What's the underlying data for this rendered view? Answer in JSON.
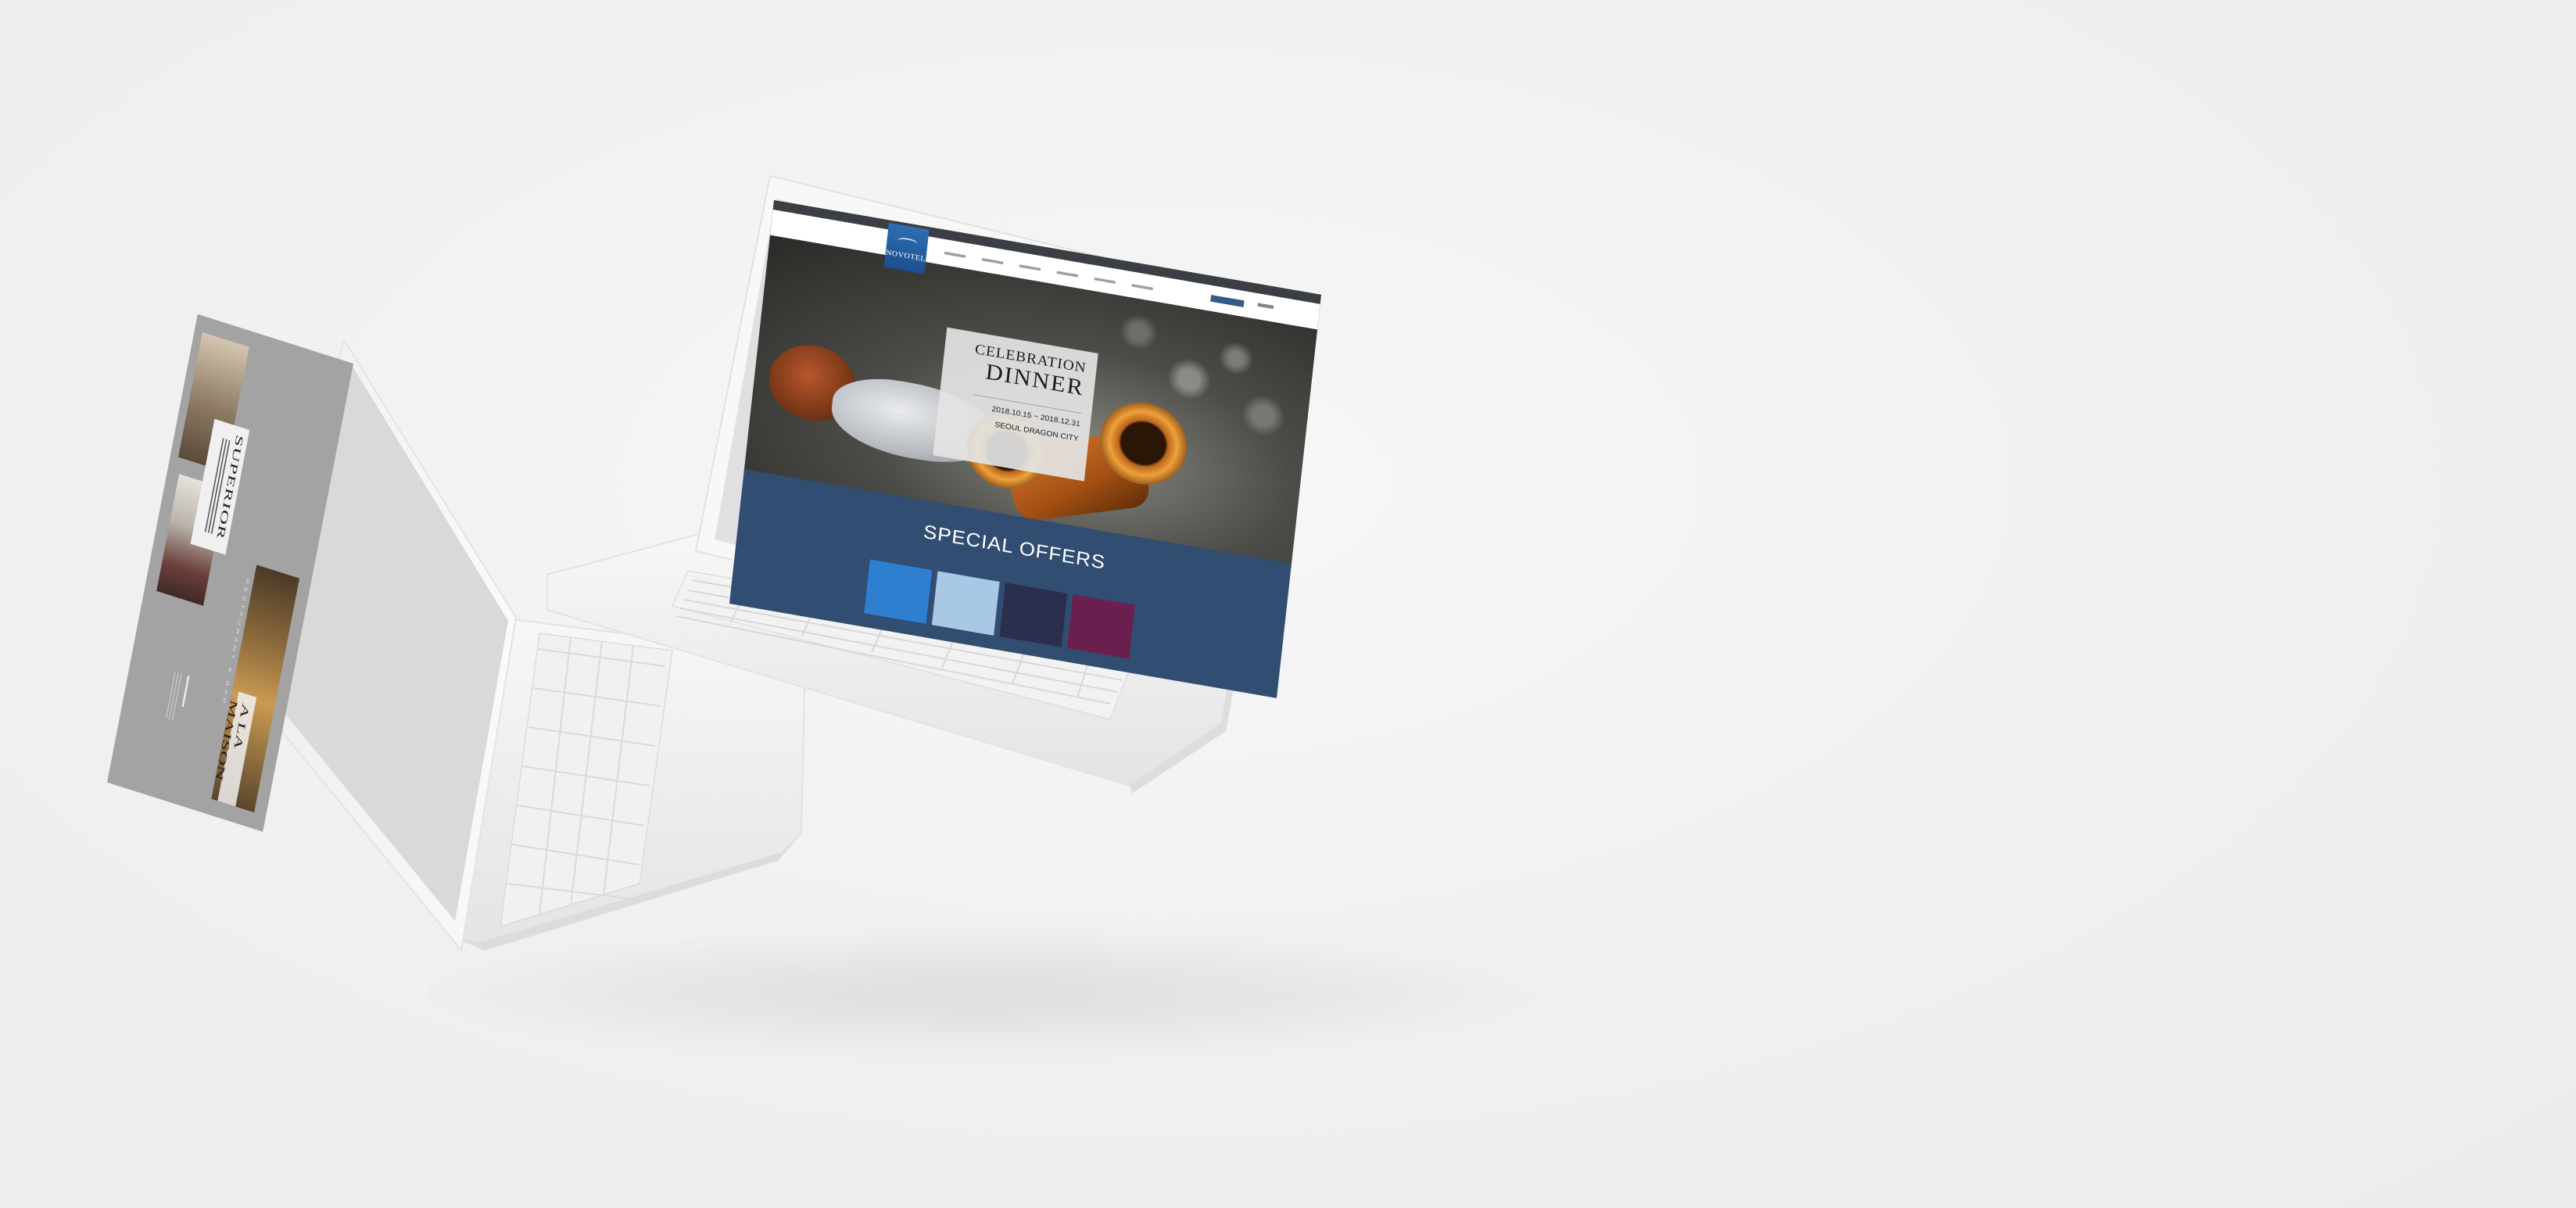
{
  "scene": {
    "description_type": "laptop-mockup",
    "background_color": "#efefef",
    "laptop_body_color": "#f6f6f6"
  },
  "laptop_front": {
    "site": {
      "logo_text": "NOVOTEL",
      "brand_color": "#2a5f9f",
      "hero": {
        "title_line1": "CELEBRATION",
        "title_line2": "DINNER",
        "dates": "2018.10.15 ~ 2018.12.31",
        "location": "SEOUL DRAGON CITY"
      },
      "offers": {
        "title": "SPECIAL OFFERS",
        "section_color": "#324d72",
        "thumbnail_colors": [
          "#2e7fd0",
          "#a9c8e6",
          "#2b2f4e",
          "#6b1f4e"
        ]
      }
    }
  },
  "laptop_back": {
    "site": {
      "room_title": "SUPERIOR",
      "restaurant_name": "A LA MAISON",
      "section_label": "RESTAURANT & BAR",
      "screen_color": "#a3a3a3"
    }
  }
}
